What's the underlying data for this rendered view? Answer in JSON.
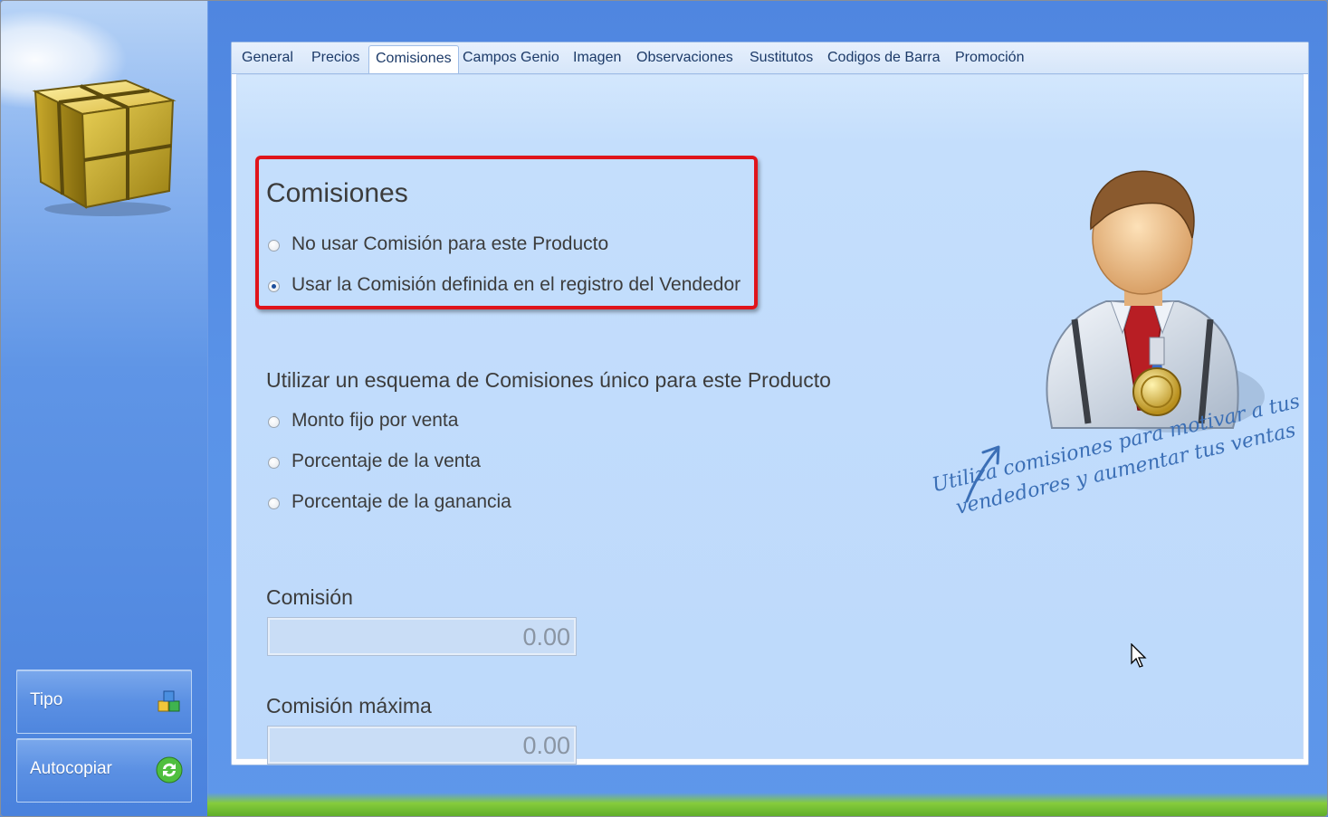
{
  "sidebar": {
    "logo_icon": "gold-box-icon",
    "buttons": [
      {
        "label": "Tipo",
        "icon": "blocks-icon"
      },
      {
        "label": "Autocopiar",
        "icon": "refresh-icon"
      }
    ]
  },
  "tabs": [
    {
      "label": "General"
    },
    {
      "label": "Precios"
    },
    {
      "label": "Comisiones",
      "active": true
    },
    {
      "label": "Campos Genio"
    },
    {
      "label": "Imagen"
    },
    {
      "label": "Observaciones"
    },
    {
      "label": "Sustitutos"
    },
    {
      "label": "Codigos de Barra"
    },
    {
      "label": "Promoción"
    }
  ],
  "commissions": {
    "title": "Comisiones",
    "options": [
      {
        "label": "No usar Comisión para este Producto",
        "checked": false
      },
      {
        "label": "Usar la Comisión definida en el registro del Vendedor",
        "checked": true
      }
    ]
  },
  "scheme": {
    "title": "Utilizar un esquema de Comisiones único para este Producto",
    "options": [
      {
        "label": "Monto fijo por venta",
        "checked": false
      },
      {
        "label": "Porcentaje de la venta",
        "checked": false
      },
      {
        "label": "Porcentaje de la ganancia",
        "checked": false
      }
    ]
  },
  "fields": {
    "commission_label": "Comisión",
    "commission_value": "0.00",
    "max_commission_label": "Comisión máxima",
    "max_commission_value": "0.00"
  },
  "illustration": {
    "icon": "salesman-medal-icon",
    "note_line1": "Utiliza comisiones para motivar a tus",
    "note_line2": "vendedores y aumentar tus ventas"
  },
  "colors": {
    "highlight": "#e0141b",
    "accent": "#4f86e0"
  }
}
